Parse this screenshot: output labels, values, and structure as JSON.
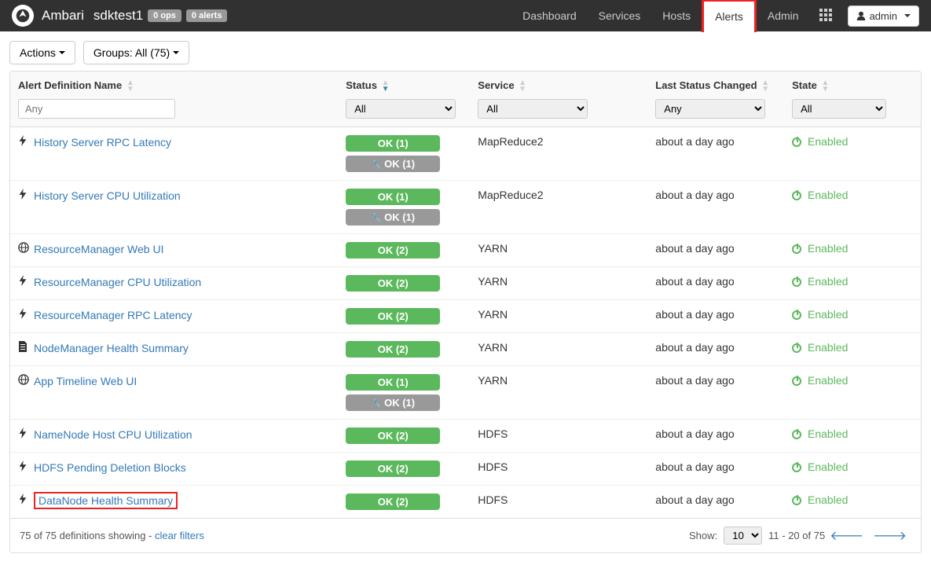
{
  "navbar": {
    "brand": "Ambari",
    "cluster": "sdktest1",
    "ops_badge": "0 ops",
    "alerts_badge": "0 alerts",
    "items": [
      "Dashboard",
      "Services",
      "Hosts",
      "Alerts",
      "Admin"
    ],
    "highlighted_index": 3,
    "user_label": "admin"
  },
  "toolbar": {
    "actions_label": "Actions",
    "groups_label": "Groups:  All (75)"
  },
  "columns": {
    "name": "Alert Definition Name",
    "status": "Status",
    "service": "Service",
    "changed": "Last Status Changed",
    "state": "State"
  },
  "filters": {
    "name_placeholder": "Any",
    "status_value": "All",
    "service_value": "All",
    "changed_value": "Any",
    "state_value": "All"
  },
  "state_label": "Enabled",
  "rows": [
    {
      "icon": "bolt",
      "name": "History Server RPC Latency",
      "statuses": [
        {
          "t": "OK (1)",
          "m": false
        },
        {
          "t": "OK (1)",
          "m": true
        }
      ],
      "service": "MapReduce2",
      "changed": "about a day ago",
      "hl": false
    },
    {
      "icon": "bolt",
      "name": "History Server CPU Utilization",
      "statuses": [
        {
          "t": "OK (1)",
          "m": false
        },
        {
          "t": "OK (1)",
          "m": true
        }
      ],
      "service": "MapReduce2",
      "changed": "about a day ago",
      "hl": false
    },
    {
      "icon": "globe",
      "name": "ResourceManager Web UI",
      "statuses": [
        {
          "t": "OK (2)",
          "m": false
        }
      ],
      "service": "YARN",
      "changed": "about a day ago",
      "hl": false
    },
    {
      "icon": "bolt",
      "name": "ResourceManager CPU Utilization",
      "statuses": [
        {
          "t": "OK (2)",
          "m": false
        }
      ],
      "service": "YARN",
      "changed": "about a day ago",
      "hl": false
    },
    {
      "icon": "bolt",
      "name": "ResourceManager RPC Latency",
      "statuses": [
        {
          "t": "OK (2)",
          "m": false
        }
      ],
      "service": "YARN",
      "changed": "about a day ago",
      "hl": false
    },
    {
      "icon": "file",
      "name": "NodeManager Health Summary",
      "statuses": [
        {
          "t": "OK (2)",
          "m": false
        }
      ],
      "service": "YARN",
      "changed": "about a day ago",
      "hl": false
    },
    {
      "icon": "globe",
      "name": "App Timeline Web UI",
      "statuses": [
        {
          "t": "OK (1)",
          "m": false
        },
        {
          "t": "OK (1)",
          "m": true
        }
      ],
      "service": "YARN",
      "changed": "about a day ago",
      "hl": false
    },
    {
      "icon": "bolt",
      "name": "NameNode Host CPU Utilization",
      "statuses": [
        {
          "t": "OK (2)",
          "m": false
        }
      ],
      "service": "HDFS",
      "changed": "about a day ago",
      "hl": false
    },
    {
      "icon": "bolt",
      "name": "HDFS Pending Deletion Blocks",
      "statuses": [
        {
          "t": "OK (2)",
          "m": false
        }
      ],
      "service": "HDFS",
      "changed": "about a day ago",
      "hl": false
    },
    {
      "icon": "bolt",
      "name": "DataNode Health Summary",
      "statuses": [
        {
          "t": "OK (2)",
          "m": false
        }
      ],
      "service": "HDFS",
      "changed": "about a day ago",
      "hl": true
    }
  ],
  "footer": {
    "summary_pre": "75 of 75 definitions showing - ",
    "clear": "clear filters",
    "show_label": "Show:",
    "show_value": "10",
    "range": "11 - 20 of 75"
  }
}
